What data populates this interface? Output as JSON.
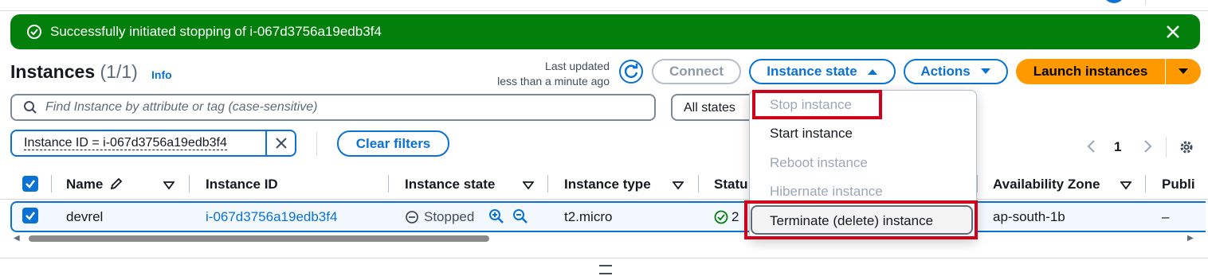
{
  "flash": {
    "message": "Successfully initiated stopping of i-067d3756a19edb3f4",
    "color": "#037f0c",
    "icon": "check-circle-icon"
  },
  "header": {
    "title": "Instances",
    "count": "(1/1)",
    "info": "Info",
    "last_updated_line1": "Last updated",
    "last_updated_line2": "less than a minute ago"
  },
  "toolbar": {
    "connect": "Connect",
    "instance_state": "Instance state",
    "actions": "Actions",
    "launch": "Launch instances"
  },
  "search": {
    "placeholder": "Find Instance by attribute or tag (case-sensitive)",
    "state_filter": "All states"
  },
  "filter_chip": {
    "label": "Instance ID = i-067d3756a19edb3f4",
    "clear": "Clear filters"
  },
  "pagination": {
    "page": "1"
  },
  "table": {
    "columns": [
      "Name",
      "Instance ID",
      "Instance state",
      "Instance type",
      "Statu",
      "Availability Zone",
      "Publi"
    ],
    "rows": [
      {
        "name": "devrel",
        "instance_id": "i-067d3756a19edb3f4",
        "state": "Stopped",
        "type": "t2.micro",
        "status_partial": "2",
        "az": "ap-south-1b",
        "public": "–"
      }
    ]
  },
  "menu": {
    "items": [
      {
        "label": "Stop instance",
        "disabled": true
      },
      {
        "label": "Start instance",
        "disabled": false
      },
      {
        "label": "Reboot instance",
        "disabled": true
      },
      {
        "label": "Hibernate instance",
        "disabled": true
      },
      {
        "label": "Terminate (delete) instance",
        "disabled": false
      }
    ]
  },
  "colors": {
    "accent": "#0972d3",
    "launch": "#ff9900",
    "highlight": "#d0021b"
  }
}
